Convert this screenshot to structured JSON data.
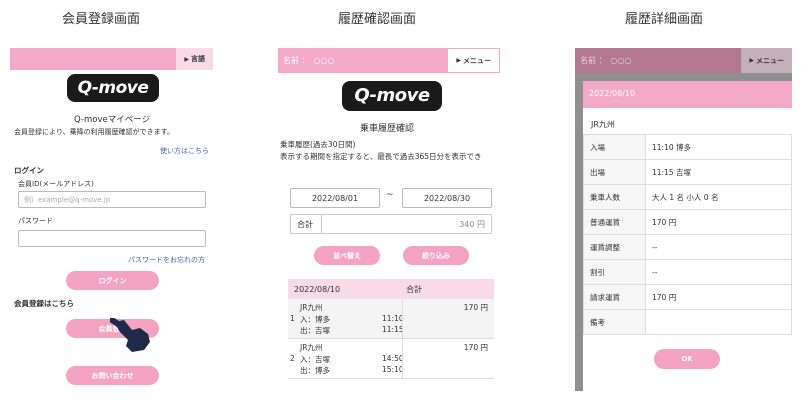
{
  "captions": {
    "registration": "会員登録画面",
    "history": "履歴確認画面",
    "detail": "履歴詳細画面"
  },
  "screen1": {
    "lang_button": "言語",
    "logo": "Q-move",
    "mypage_title": "Q-moveマイページ",
    "intro": "会員登録により、乗降の利用履歴確認ができます。",
    "howto_link": "使い方はこちら",
    "login_heading": "ログイン",
    "id_label": "会員ID(メールアドレス)",
    "id_placeholder": "例）example@q-move.jp",
    "password_label": "パスワード",
    "password_placeholder": "",
    "forgot_link": "パスワードをお忘れの方",
    "login_button": "ログイン",
    "register_heading": "会員登録はこちら",
    "register_button": "会員登録",
    "contact_button": "お問い合わせ"
  },
  "screen2": {
    "name_label": "名前 ：　○○○",
    "menu_button": "メニュー",
    "logo": "Q-move",
    "page_title": "乗車履歴確認",
    "subtitle": "乗車履歴(過去30日間)",
    "instructions": "表示する期間を指定すると、最長で過去365日分を表示でき",
    "date_from": "2022/08/01",
    "date_sep": "~",
    "date_to": "2022/08/30",
    "total_label": "合計",
    "total_value": "340 円",
    "sort_button": "並べ替え",
    "filter_button": "絞り込み",
    "list_header_date": "2022/08/10",
    "list_header_total": "合計",
    "trips": [
      {
        "no": "1",
        "operator": "JR九州",
        "in_label": "入：",
        "in_station": "博多",
        "in_time": "11:10",
        "out_label": "出：",
        "out_station": "吉塚",
        "out_time": "11:15",
        "fare": "170 円"
      },
      {
        "no": "2",
        "operator": "JR九州",
        "in_label": "入：",
        "in_station": "吉塚",
        "in_time": "14:50",
        "out_label": "出：",
        "out_station": "博多",
        "out_time": "15:10",
        "fare": "170 円"
      }
    ]
  },
  "screen3": {
    "name_label": "名前 ：　○○○",
    "menu_button": "メニュー",
    "date": "2022/08/10",
    "operator": "JR九州",
    "rows": [
      {
        "label": "入場",
        "value": "11:10 博多"
      },
      {
        "label": "出場",
        "value": "11:15 吉塚"
      },
      {
        "label": "乗車人数",
        "value": "大人 1 名  小人 0 名"
      },
      {
        "label": "普通運賃",
        "value": "170 円"
      },
      {
        "label": "運賃調整",
        "value": "--"
      },
      {
        "label": "割引",
        "value": "--"
      },
      {
        "label": "請求運賃",
        "value": "170 円"
      },
      {
        "label": "備考",
        "value": ""
      }
    ],
    "ok_button": "OK"
  },
  "colors": {
    "pink": "#f3a9c7",
    "light_pink": "#f8dbe7",
    "dim_pink": "#b47891",
    "link": "#4a5fb0"
  },
  "icons": {
    "pointer": "hand-pointer-icon"
  }
}
